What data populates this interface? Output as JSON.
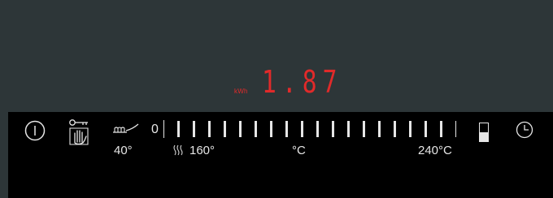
{
  "display": {
    "energy_unit": "kWh",
    "energy_value": "1.87",
    "value_color": "#e12a2a"
  },
  "controls": {
    "power_icon": "power-icon",
    "lock_icon": "key-hand-lock-icon",
    "keep_warm_icon": "keep-warm-icon",
    "keep_warm_label": "40°",
    "slider_start": "0",
    "heat_icon": "heat-waves-icon",
    "temp_mid_label": "160°",
    "unit_label": "°C",
    "temp_max_label": "240°C",
    "level_indicator_icon": "level-indicator-icon",
    "timer_icon": "clock-icon"
  },
  "slider": {
    "ticks": 19,
    "min_label": "0",
    "max_label": "240°C",
    "level_fraction": 0.5
  }
}
